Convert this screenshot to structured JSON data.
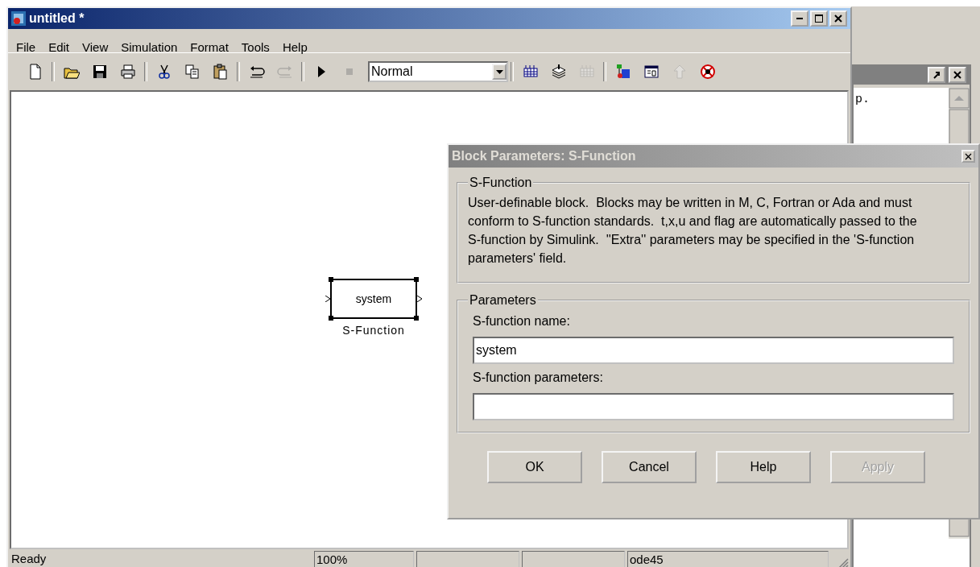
{
  "main_window": {
    "title": "untitled *",
    "active": true,
    "menu": [
      "File",
      "Edit",
      "View",
      "Simulation",
      "Format",
      "Tools",
      "Help"
    ],
    "toolbar": [
      {
        "kind": "button",
        "disabled": false
      },
      {
        "kind": "separator"
      },
      {
        "kind": "button",
        "disabled": false
      },
      {
        "kind": "button",
        "disabled": false
      },
      {
        "kind": "button",
        "disabled": false
      },
      {
        "kind": "separator"
      },
      {
        "kind": "button",
        "disabled": false
      },
      {
        "kind": "button",
        "disabled": false
      },
      {
        "kind": "button",
        "disabled": false
      },
      {
        "kind": "separator"
      },
      {
        "kind": "button",
        "disabled": false
      },
      {
        "kind": "button",
        "disabled": true
      },
      {
        "kind": "separator"
      },
      {
        "kind": "button",
        "disabled": false
      },
      {
        "kind": "button",
        "disabled": true
      },
      {
        "kind": "dropdown",
        "value": "Normal"
      },
      {
        "kind": "separator"
      },
      {
        "kind": "button",
        "disabled": false
      },
      {
        "kind": "button",
        "disabled": false
      },
      {
        "kind": "button",
        "disabled": true
      },
      {
        "kind": "separator"
      },
      {
        "kind": "button",
        "disabled": false
      },
      {
        "kind": "button",
        "disabled": false
      },
      {
        "kind": "button",
        "disabled": true
      },
      {
        "kind": "button",
        "disabled": false
      }
    ],
    "canvas": {
      "block": {
        "label": "system",
        "name": "S-Function",
        "selected": true
      }
    },
    "status_bar": {
      "message": "Ready",
      "zoom": "100%",
      "solver": "ode45"
    }
  },
  "background_window": {
    "text": "p."
  },
  "dialog": {
    "title": "Block Parameters: S-Function",
    "active": false,
    "description": {
      "title": "S-Function",
      "text": "User-definable block.  Blocks may be written in M, C, Fortran or Ada and must  conform to S-function standards.  t,x,u and flag are automatically passed to the S-function by Simulink.  ''Extra'' parameters may be specified in the 'S-function parameters' field."
    },
    "parameters": {
      "title": "Parameters",
      "fields": [
        {
          "label": "S-function name:",
          "value": "system"
        },
        {
          "label": "S-function parameters:"
        }
      ]
    },
    "buttons": [
      {
        "label": "OK",
        "disabled": false
      },
      {
        "label": "Cancel",
        "disabled": false
      },
      {
        "label": "Help",
        "disabled": false
      },
      {
        "label": "Apply",
        "disabled": true
      }
    ]
  }
}
